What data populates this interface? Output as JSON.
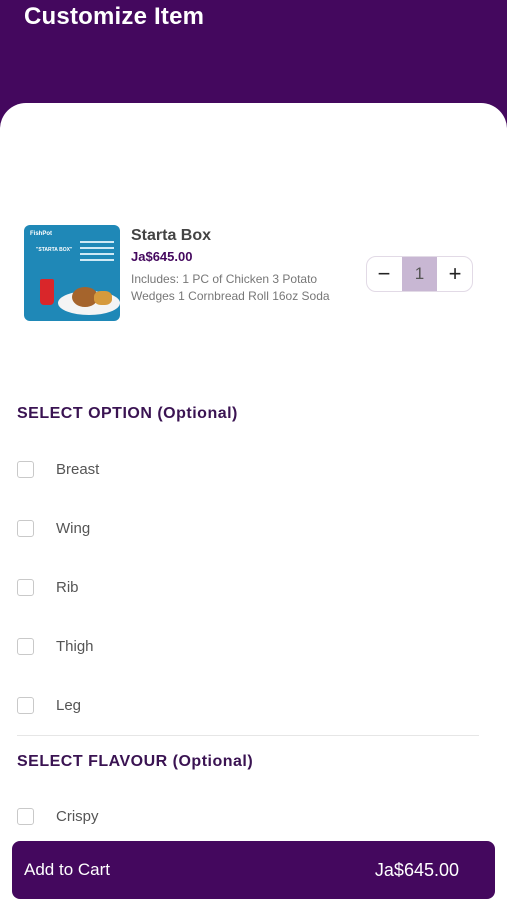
{
  "header": {
    "title": "Customize Item"
  },
  "product": {
    "name": "Starta Box",
    "price": "Ja$645.00",
    "description": "Includes:    1 PC of Chicken    3 Potato Wedges    1 Cornbread Roll 16oz Soda",
    "image_text": {
      "brand": "FishPot",
      "box_title": "\"STARTA BOX\""
    }
  },
  "quantity": {
    "minus": "−",
    "value": "1",
    "plus": "+"
  },
  "sections": {
    "option": {
      "title": "SELECT OPTION (Optional)",
      "items": [
        "Breast",
        "Wing",
        "Rib",
        "Thigh",
        "Leg"
      ]
    },
    "flavour": {
      "title": "SELECT FLAVOUR (Optional)",
      "items": [
        "Crispy"
      ]
    }
  },
  "footer": {
    "label": "Add to Cart",
    "total": "Ja$645.00"
  },
  "colors": {
    "brand": "#44085e",
    "stepper_value_bg": "#c8b7d3"
  }
}
